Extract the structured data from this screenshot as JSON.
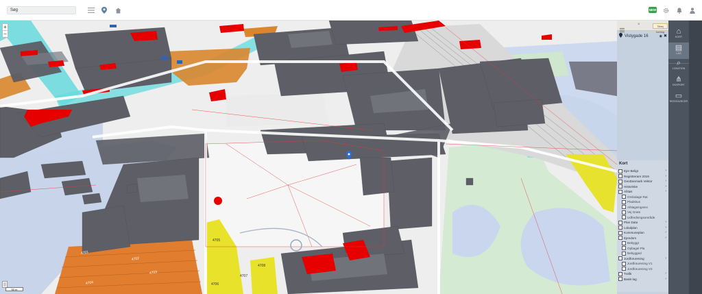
{
  "topbar": {
    "search_value": "Søg",
    "badge_label": "NEW"
  },
  "map": {
    "zoom_in": "+",
    "zoom_out": "−",
    "scale_label": "50 m",
    "area_labels": [
      "4701",
      "4702",
      "4703",
      "4704",
      "4705",
      "4706",
      "4707",
      "4708"
    ]
  },
  "panel": {
    "tab_label": "Tilfæj kortlag",
    "address": "Vistygade 16"
  },
  "layers": {
    "title": "Kort",
    "items": [
      {
        "label": "Ejer Beligt",
        "sub": false
      },
      {
        "label": "Registreranr 2019",
        "sub": false
      },
      {
        "label": "GeoDanmark Vektor",
        "sub": false
      },
      {
        "label": "Historiske",
        "sub": false
      },
      {
        "label": "Afstøt",
        "sub": false
      },
      {
        "label": "Ombalage Rat",
        "sub": true
      },
      {
        "label": "Pladsbus",
        "sub": true
      },
      {
        "label": "Afslagningsrec",
        "sub": true
      },
      {
        "label": "Vej Grate",
        "sub": true
      },
      {
        "label": "Udfredningsområde",
        "sub": true
      },
      {
        "label": "Plan Data",
        "sub": false
      },
      {
        "label": "Lokalplan",
        "sub": false
      },
      {
        "label": "Kommuneplan",
        "sub": false
      },
      {
        "label": "Ejendom",
        "sub": false
      },
      {
        "label": "Bebyggt",
        "sub": true
      },
      {
        "label": "Opbagel Pla",
        "sub": true
      },
      {
        "label": "Bebygged",
        "sub": true
      },
      {
        "label": "Jordforurening",
        "sub": false
      },
      {
        "label": "Jordforurening V1",
        "sub": true
      },
      {
        "label": "Jordforurening V2",
        "sub": true
      },
      {
        "label": "Trafik",
        "sub": false
      },
      {
        "label": "Basis lag",
        "sub": false
      }
    ]
  },
  "rail": {
    "items": [
      {
        "icon": "home-map-icon",
        "label": "KORT"
      },
      {
        "icon": "layers-icon",
        "label": "LAG"
      },
      {
        "icon": "search-pin-icon",
        "label": "LOKATION"
      },
      {
        "icon": "share-icon",
        "label": "EKSPORT"
      },
      {
        "icon": "document-icon",
        "label": "RESSOURCER"
      }
    ]
  },
  "colors": {
    "building": "#5d5e66",
    "commercial_red": "#e60000",
    "orange_zone": "#d9862e",
    "yellow_zone": "#e8e02a",
    "cyan_zone": "#5fd8dc",
    "water": "#c7d4ea",
    "park": "#cfe6cf",
    "rail_bg": "#4c5460"
  }
}
